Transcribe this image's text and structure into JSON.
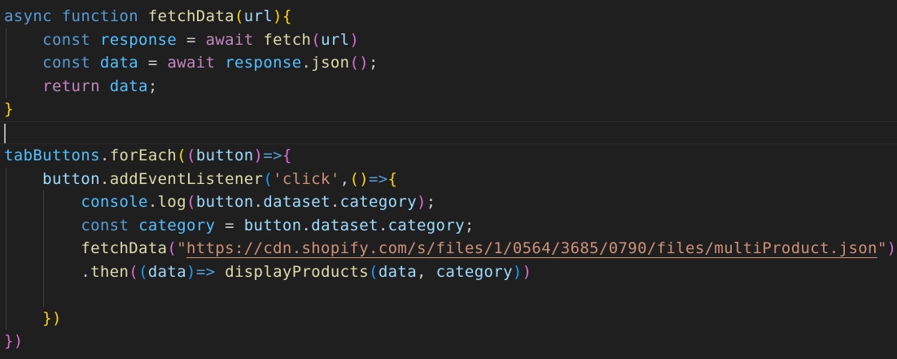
{
  "code": {
    "l1": {
      "t1": "async",
      "t2": " ",
      "t3": "function",
      "t4": " ",
      "t5": "fetchData",
      "t6": "(",
      "t7": "url",
      "t8": ")",
      "t9": "{"
    },
    "l2": {
      "t1": "const",
      "t2": " ",
      "t3": "response",
      "t4": " = ",
      "t5": "await",
      "t6": " ",
      "t7": "fetch",
      "t8": "(",
      "t9": "url",
      "t10": ")"
    },
    "l3": {
      "t1": "const",
      "t2": " ",
      "t3": "data",
      "t4": " = ",
      "t5": "await",
      "t6": " ",
      "t7": "response",
      "t8": ".",
      "t9": "json",
      "t10": "()",
      "t11": ";"
    },
    "l4": {
      "t1": "return",
      "t2": " ",
      "t3": "data",
      "t4": ";"
    },
    "l5": {
      "t1": "}"
    },
    "l7": {
      "t1": "tabButtons",
      "t2": ".",
      "t3": "forEach",
      "t4": "(",
      "t5": "(",
      "t6": "button",
      "t7": ")",
      "t8": "=>",
      "t9": "{"
    },
    "l8": {
      "t1": "button",
      "t2": ".",
      "t3": "addEventListener",
      "t4": "(",
      "t5": "'click'",
      "t6": ",",
      "t7": "()",
      "t8": "=>",
      "t9": "{"
    },
    "l9": {
      "t1": "console",
      "t2": ".",
      "t3": "log",
      "t4": "(",
      "t5": "button",
      "t6": ".",
      "t7": "dataset",
      "t8": ".",
      "t9": "category",
      "t10": ")",
      "t11": ";"
    },
    "l10": {
      "t1": "const",
      "t2": " ",
      "t3": "category",
      "t4": " = ",
      "t5": "button",
      "t6": ".",
      "t7": "dataset",
      "t8": ".",
      "t9": "category",
      "t10": ";"
    },
    "l11": {
      "t1": "fetchData",
      "t2": "(",
      "t3": "\"",
      "t4": "https://cdn.shopify.com/s/files/1/0564/3685/0790/files/multiProduct.json",
      "t5": "\"",
      "t6": ")"
    },
    "l12": {
      "t1": ".",
      "t2": "then",
      "t3": "(",
      "t4": "(",
      "t5": "data",
      "t6": ")",
      "t7": "=>",
      "t8": " ",
      "t9": "displayProducts",
      "t10": "(",
      "t11": "data",
      "t12": ", ",
      "t13": "category",
      "t14": ")",
      "t15": ")"
    },
    "l14": {
      "t1": "})"
    },
    "l15": {
      "t1": "})"
    }
  }
}
